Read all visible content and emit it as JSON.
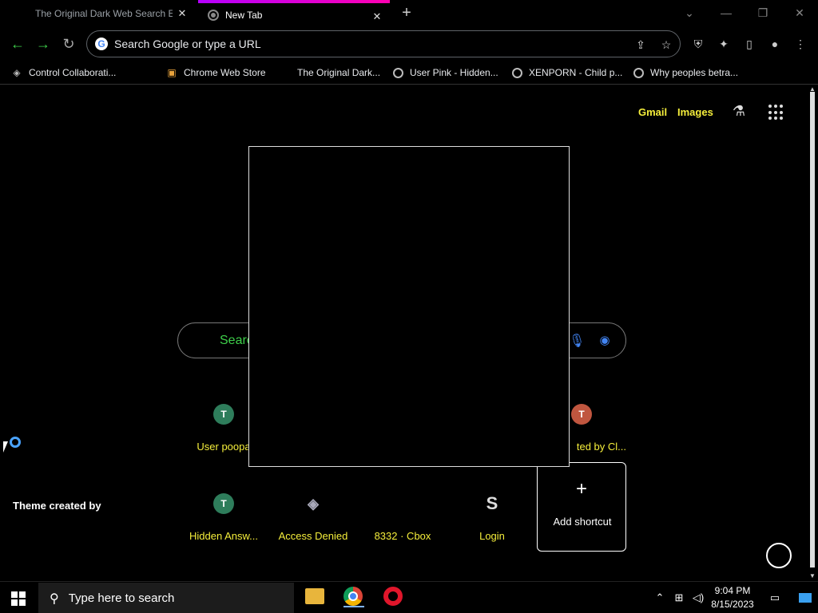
{
  "tabs": [
    {
      "title": "The Original Dark Web Search En",
      "active": false
    },
    {
      "title": "New Tab",
      "active": true
    }
  ],
  "toolbar": {
    "omnibox_placeholder": "Search Google or type a URL",
    "google_letter": "G"
  },
  "bookmarks": [
    {
      "label": "Control Collaborati...",
      "icon": "app-icon"
    },
    {
      "label": "Chrome Web Store",
      "icon": "web-store-icon"
    },
    {
      "label": "The Original Dark...",
      "icon": "none"
    },
    {
      "label": "User Pink - Hidden...",
      "icon": "globe-icon"
    },
    {
      "label": "XENPORN - Child p...",
      "icon": "globe-icon"
    },
    {
      "label": "Why peoples betra...",
      "icon": "globe-icon"
    }
  ],
  "ntp": {
    "gmail": "Gmail",
    "images": "Images",
    "search_placeholder": "Searc",
    "theme_credit": "Theme created by",
    "accent_color": "#f5ee3b"
  },
  "shortcuts": [
    {
      "label": "User poopa",
      "letter": "T",
      "color": "#2e7d5b"
    },
    {
      "label": "ted by Cl...",
      "letter": "T",
      "color": "#c0563f"
    },
    {
      "label": "Hidden Answ...",
      "letter": "T",
      "color": "#2e7d5b"
    },
    {
      "label": "Access Denied",
      "letter": "",
      "color": "#000000"
    },
    {
      "label": "8332 · Cbox",
      "letter": "",
      "color": "#000000"
    },
    {
      "label": "Login",
      "letter": "S",
      "color": "#000000"
    },
    {
      "label": "Add shortcut",
      "letter": "+",
      "color": "#000000"
    }
  ],
  "taskbar": {
    "search_placeholder": "Type here to search",
    "time": "9:04 PM",
    "date": "8/15/2023"
  }
}
